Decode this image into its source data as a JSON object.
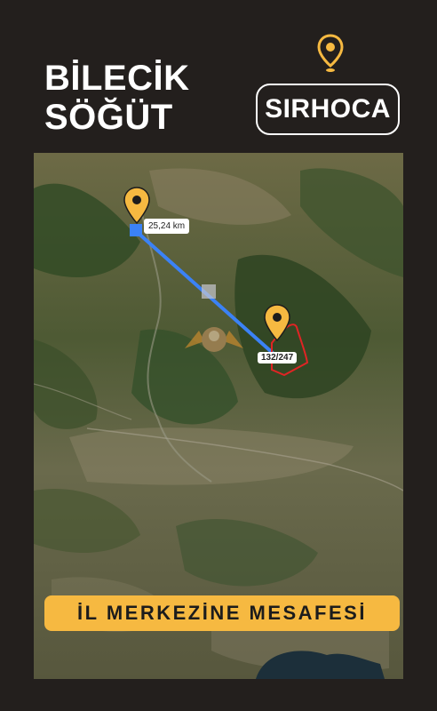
{
  "header": {
    "title_line1": "BİLECİK",
    "title_line2": "SÖĞÜT",
    "brand": "SIRHOCA"
  },
  "map": {
    "distance_label": "25,24 km",
    "parcel_label": "132/247",
    "banner": "İL MERKEZİNE MESAFESİ"
  },
  "colors": {
    "background": "#231f1d",
    "accent": "#f6b941",
    "route_line": "#3b82f6",
    "parcel_outline": "#e02424"
  }
}
